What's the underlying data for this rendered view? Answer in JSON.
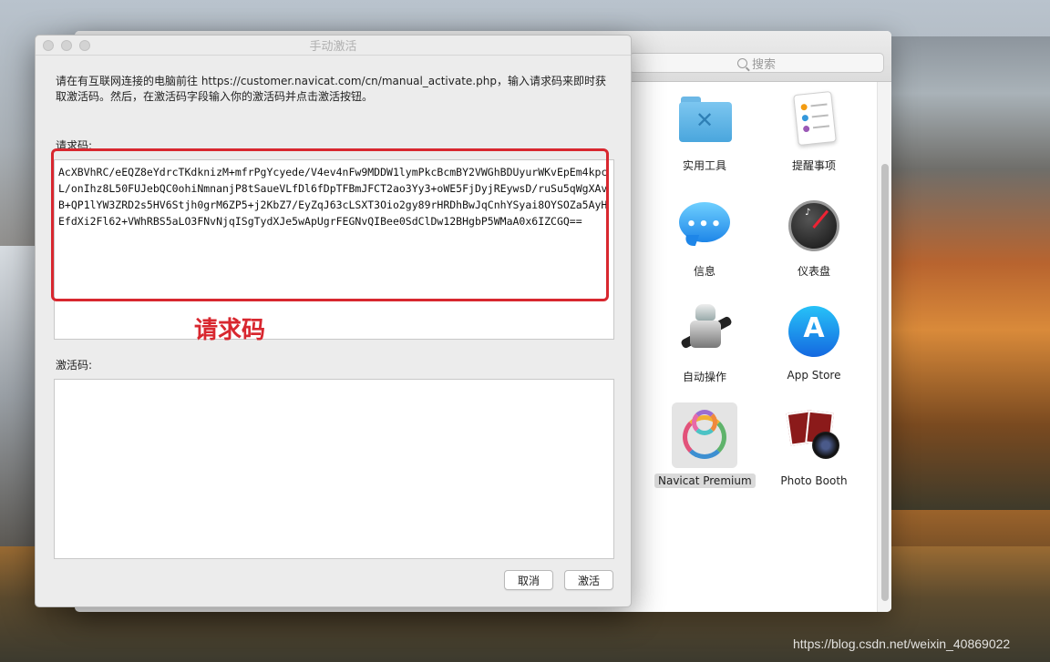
{
  "dialog": {
    "title": "手动激活",
    "instructions": "请在有互联网连接的电脑前往 https://customer.navicat.com/cn/manual_activate.php，输入请求码来即时获取激活码。然后，在激活码字段输入你的激活码并点击激活按钮。",
    "request_label": "请求码:",
    "request_code": "AcXBVhRC/eEQZ8eYdrcTKdknizM+mfrPgYcyede/V4ev4nFw9MDDW1lymPkcBcmBY2VWGhBDUyurWKvEpEm4kpcL/onIhz8L50FUJebQC0ohiNmnanjP8tSaueVLfDl6fDpTFBmJFCT2ao3Yy3+oWE5FjDyjREywsD/ruSu5qWgXAvB+QP1lYW3ZRD2s5HV6Stjh0grM6ZP5+j2KbZ7/EyZqJ63cLSXT3Oio2gy89rHRDhBwJqCnhYSyai8OYSOZa5AyHEfdXi2Fl62+VWhRBS5aLO3FNvNjqISgTydXJe5wApUgrFEGNvQIBee0SdClDw12BHgbP5WMaA0x6IZCGQ==",
    "annotation": "请求码",
    "activation_label": "激活码:",
    "activation_code": "",
    "cancel_label": "取消",
    "activate_label": "激活",
    "accent_color": "#d8272f"
  },
  "apps_window": {
    "search_placeholder": "搜索",
    "items": [
      {
        "label": "实用工具",
        "icon": "utilities-folder-icon"
      },
      {
        "label": "提醒事项",
        "icon": "reminders-icon"
      },
      {
        "label": "信息",
        "icon": "messages-icon"
      },
      {
        "label": "仪表盘",
        "icon": "dashboard-icon"
      },
      {
        "label": "自动操作",
        "icon": "automator-icon"
      },
      {
        "label": "App Store",
        "icon": "app-store-icon"
      },
      {
        "label": "Navicat Premium",
        "icon": "navicat-premium-icon",
        "selected": true
      },
      {
        "label": "Photo Booth",
        "icon": "photo-booth-icon"
      }
    ]
  },
  "watermark": "https://blog.csdn.net/weixin_40869022"
}
